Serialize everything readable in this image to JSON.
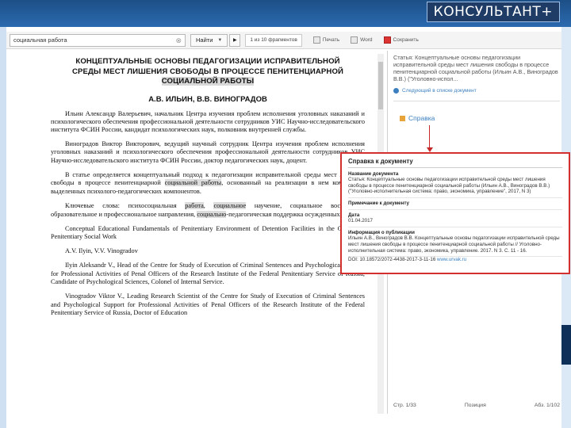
{
  "brand": {
    "label": "КОНСУЛЬТАНТ+"
  },
  "toolbar": {
    "search_value": "социальная работа",
    "find_label": "Найти",
    "fragments_label": "1 из 10 фрагментов",
    "tool1_label": "Печать",
    "tool2_label": "Word",
    "tool3_label": "Сохранить"
  },
  "document": {
    "title_line1": "КОНЦЕПТУАЛЬНЫЕ ОСНОВЫ ПЕДАГОГИЗАЦИИ ИСПРАВИТЕЛЬНОЙ",
    "title_line2": "СРЕДЫ МЕСТ ЛИШЕНИЯ СВОБОДЫ В ПРОЦЕССЕ ПЕНИТЕНЦИАРНОЙ",
    "title_line3": "СОЦИАЛЬНОЙ РАБОТЫ",
    "authors": "А.В. ИЛЬИН, В.В. ВИНОГРАДОВ",
    "para1": "Ильин Александр Валерьевич, начальник Центра изучения проблем исполнения уголовных наказаний и психологического обеспечения профессиональной деятельности сотрудников УИС Научно-исследовательского института ФСИН России, кандидат психологических наук, полковник внутренней службы.",
    "para2": "Виноградов Виктор Викторович, ведущий научный сотрудник Центра изучения проблем исполнения уголовных наказаний и психологического обеспечения профессиональной деятельности сотрудников УИС Научно-исследовательского института ФСИН России, доктор педагогических наук, доцент.",
    "para3_a": "В статье определяется концептуальный подход к педагогизации исправительной среды мест лишения свободы в процессе пенитенциарной ",
    "para3_hl1": "социальной работы",
    "para3_b": ", основанный на реализации в нем комплексов выделенных психолого-педагогических компонентов.",
    "para4_a": "Ключевые слова: психосоциальная ",
    "para4_hl1": "работа",
    "para4_b": ", ",
    "para4_hl2": "социальное",
    "para4_c": " научение, социальное воспитание, образовательное и профессиональное направления, ",
    "para4_hl3": "социально",
    "para4_d": "-педагогическая поддержка осужденных.",
    "para5": "Conceptual Educational Fundamentals of Penitentiary Environment of Detention Facilities in the Course of Penitentiary Social Work",
    "para6": "A.V. Ilyin, V.V. Vinogradov",
    "para7": "Ilyin Aleksandr V., Head of the Centre for Study of Execution of Criminal Sentences and Psychological Support for Professional Activities of Penal Officers of the Research Institute of the Federal Penitentiary Service of Russia, Candidate of Psychological Sciences, Colonel of Internal Service.",
    "para8": "Vinogradov Viktor V., Leading Research Scientist of the Centre for Study of Execution of Criminal Sentences and Psychological Support for Professional Activities of Penal Officers of the Research Institute of the Federal Penitentiary Service of Russia, Doctor of Education"
  },
  "info_panel": {
    "article_text": "Статья: Концептуальные основы педагогизации исправительной среды мест лишения свободы в процессе пенитенциарной социальной работы (Ильин А.В., Виноградов В.В.) (\"Уголовно-испол...",
    "next_doc_label": "Следующий в списке документ",
    "help_label": "Справка"
  },
  "popup": {
    "title": "Справка к документу",
    "section1_head": "Название документа",
    "section1_text": "Статья: Концептуальные основы педагогизации исправительной среды мест лишения свободы в процессе пенитенциарной социальной работы (Ильин А.В., Виноградов В.В.) (\"Уголовно-исполнительная система: право, экономика, управление\", 2017, N 3)",
    "section2_head": "Примечание к документу",
    "section3_head": "Дата",
    "section3_text": "01.04.2017",
    "section4_head": "Информация о публикации",
    "section4_text": "Ильин А.В., Виноградов В.В. Концептуальные основы педагогизации исправительной среды мест лишения свободы в процессе пенитенциарной социальной работы // Уголовно-исполнительная система: право, экономика, управление. 2017. N 3. С. 11 - 16.",
    "doi_text": "DOI: 10.18572/2072-4438-2017-3-11-16",
    "site_text": "www.urvak.ru"
  },
  "status_bar": {
    "page_label": "Стр. 1/33",
    "position_label": "Позиция",
    "scale_label": "Абз. 1/102"
  }
}
